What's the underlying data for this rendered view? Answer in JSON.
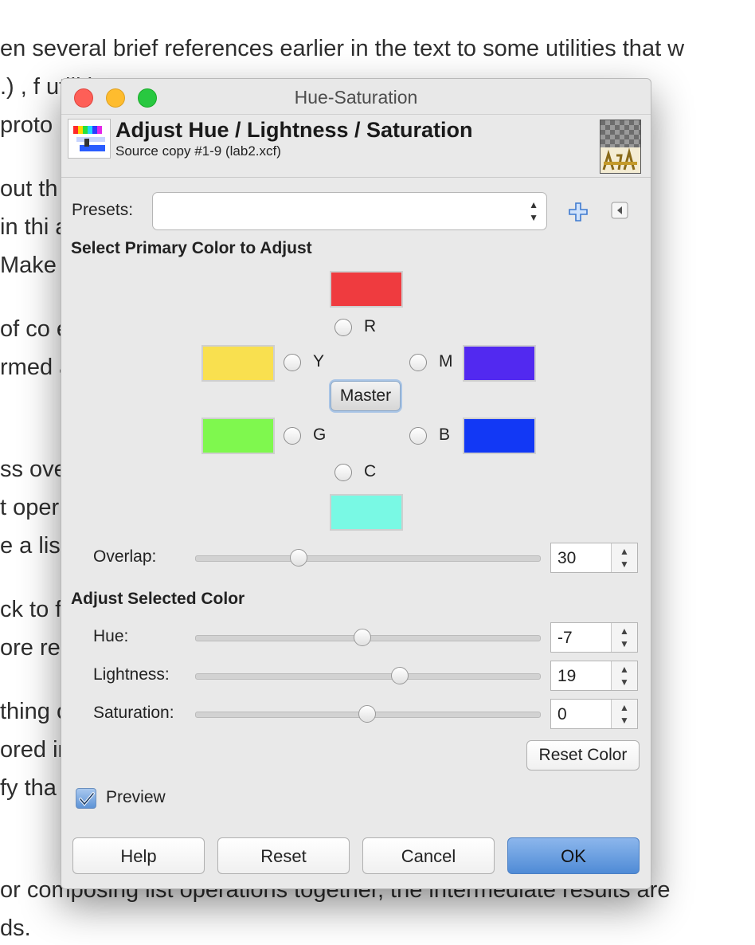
{
  "background": {
    "lines": [
      "en several brief references earlier in the text to some utilities that w",
      ".) ,  f                                                              utilities ar",
      "proto                                                                     r list oper",
      "out th                                                                   ceptually w",
      " in thi                                                                    are import",
      "Make                                                                      mind.",
      "of co                                                                       e of this b",
      "rmed                                                                      array); it's",
      "ss ove                                                                    . Some of",
      "t oper                                                                     e of tasks",
      "e a lis                                                                     ndividuall",
      "ck to                                                                       from imp",
      "ore rea",
      "thing                                                                     ode, each",
      "ored in                                                                   e imperati",
      "fy tha                                                                      utation of",
      "or composing list operations together, the intermediate results are",
      "ds."
    ]
  },
  "window": {
    "title": "Hue-Saturation"
  },
  "header": {
    "title": "Adjust Hue / Lightness / Saturation",
    "subtitle": "Source copy #1-9 (lab2.xcf)"
  },
  "presets": {
    "label": "Presets:",
    "value": ""
  },
  "primary": {
    "heading": "Select Primary Color to Adjust",
    "master_label": "Master",
    "colors": {
      "R": "#ef3b3f",
      "Y": "#f9e04f",
      "M": "#5229f0",
      "G": "#7ff84e",
      "B": "#1238f5",
      "C": "#79f9e4"
    },
    "labels": {
      "R": "R",
      "Y": "Y",
      "M": "M",
      "G": "G",
      "B": "B",
      "C": "C"
    }
  },
  "overlap": {
    "label": "Overlap:",
    "value": "30",
    "fraction": 0.3
  },
  "adjust": {
    "heading": "Adjust Selected Color",
    "hue": {
      "label": "Hue:",
      "value": "-7",
      "fraction": 0.485
    },
    "lightness": {
      "label": "Lightness:",
      "value": "19",
      "fraction": 0.595
    },
    "saturation": {
      "label": "Saturation:",
      "value": "0",
      "fraction": 0.5
    },
    "reset_color_label": "Reset Color"
  },
  "preview": {
    "label": "Preview",
    "checked": true
  },
  "buttons": {
    "help": "Help",
    "reset": "Reset",
    "cancel": "Cancel",
    "ok": "OK"
  },
  "colors": {
    "ok_button": "#5b95dc",
    "dialog_bg": "#e9e9e9"
  }
}
